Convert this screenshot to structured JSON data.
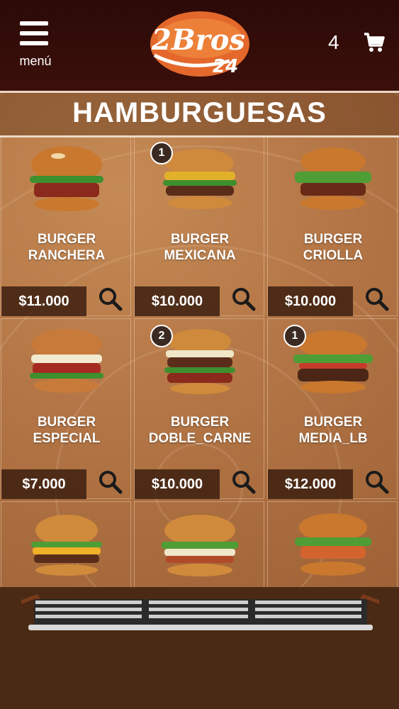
{
  "header": {
    "menu_label": "menú",
    "logo_text_top": "2Bros",
    "logo_text_bottom": "24",
    "cart_count": "4"
  },
  "page": {
    "title": "HAMBURGUESAS"
  },
  "products": [
    {
      "name_line1": "BURGER",
      "name_line2": "RANCHERA",
      "price": "$11.000",
      "badge": ""
    },
    {
      "name_line1": "BURGER",
      "name_line2": "MEXICANA",
      "price": "$10.000",
      "badge": "1"
    },
    {
      "name_line1": "BURGER",
      "name_line2": "CRIOLLA",
      "price": "$10.000",
      "badge": ""
    },
    {
      "name_line1": "BURGER",
      "name_line2": "ESPECIAL",
      "price": "$7.000",
      "badge": ""
    },
    {
      "name_line1": "BURGER",
      "name_line2": "DOBLE_CARNE",
      "price": "$10.000",
      "badge": "2"
    },
    {
      "name_line1": "BURGER",
      "name_line2": "MEDIA_LB",
      "price": "$12.000",
      "badge": "1"
    }
  ],
  "colors": {
    "header_bg": "#3b0f0a",
    "price_bg": "#3c1e0f",
    "board": "#b47646"
  },
  "icons": {
    "menu": "hamburger-menu-icon",
    "cart": "shopping-cart-icon",
    "zoom": "magnifier-icon"
  }
}
